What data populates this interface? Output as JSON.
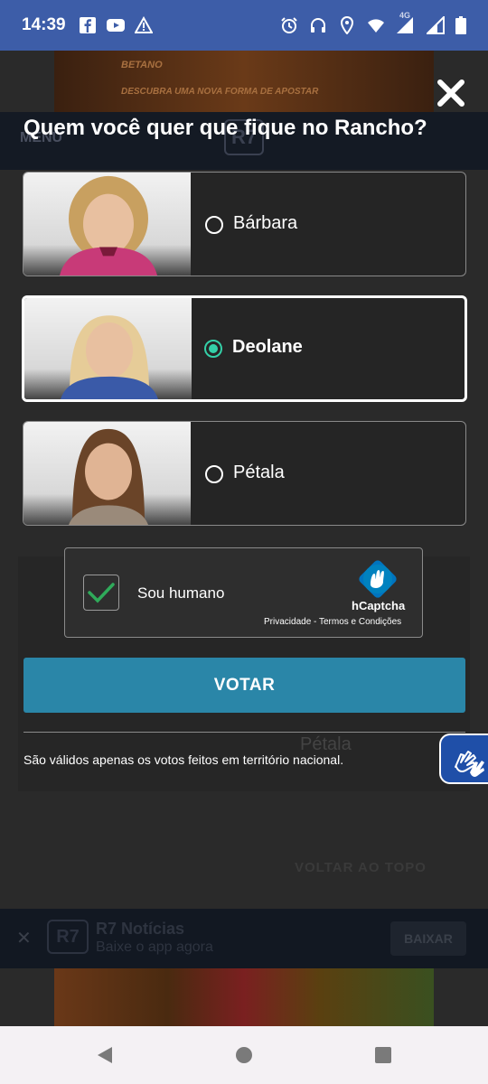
{
  "status_bar": {
    "time": "14:39",
    "left_icons": [
      "facebook-icon",
      "youtube-icon",
      "warning-icon"
    ],
    "right_icons": [
      "alarm-icon",
      "headset-icon",
      "location-icon",
      "wifi-icon",
      "signal-4g-icon",
      "signal-icon",
      "battery-icon"
    ],
    "network_label": "4G"
  },
  "background_page": {
    "ad_logo": "BETANO",
    "ad_tagline": "DESCUBRA UMA NOVA FORMA DE APOSTAR",
    "menu_label": "MENU",
    "logo_text": "R7",
    "petala_label": "Pétala",
    "back_to_top": "VOLTAR AO TOPO",
    "app_banner": {
      "logo_text": "R7",
      "title": "R7 Notícias",
      "subtitle": "Baixe o app agora",
      "button": "BAIXAR"
    }
  },
  "modal": {
    "title": "Quem você quer que fique no Rancho?",
    "options": [
      {
        "name": "Bárbara",
        "selected": false
      },
      {
        "name": "Deolane",
        "selected": true
      },
      {
        "name": "Pétala",
        "selected": false
      }
    ],
    "captcha": {
      "label": "Sou humano",
      "checked": true,
      "brand": "hCaptcha",
      "privacy_link": "Privacidade",
      "separator": " - ",
      "terms_link": "Termos e Condições"
    },
    "vote_button": "VOTAR",
    "disclaimer": "São válidos apenas os votos feitos em território nacional."
  },
  "colors": {
    "status_bar": "#3d5da8",
    "accent_radio": "#34d0a8",
    "vote_button": "#2a86a8",
    "a11y_button": "#1f4fa8"
  }
}
